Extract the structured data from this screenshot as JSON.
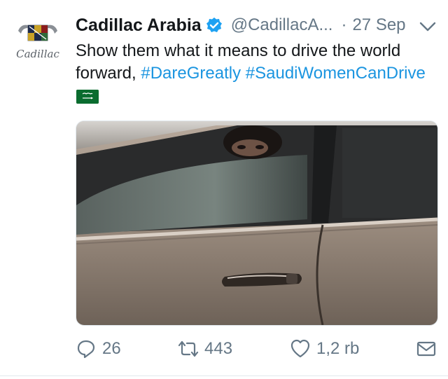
{
  "tweet": {
    "author_name": "Cadillac Arabia",
    "author_handle": "@CadillacA...",
    "separator": "·",
    "timestamp": "27 Sep",
    "logo_text": "Cadillac",
    "verified": true,
    "text_plain": "Show them what it means to drive the world forward, ",
    "hashtag_1": "#DareGreatly",
    "hashtag_2": "#SaudiWomenCanDrive",
    "flag_emoji_name": "saudi-arabia-flag",
    "media_description": "photo",
    "colors": {
      "hashtag": "#1b95e0",
      "verified": "#1da1f2",
      "meta": "#657786",
      "flag": "#0a6c2f"
    }
  },
  "actions": {
    "replies": "26",
    "retweets": "443",
    "likes": "1,2 rb",
    "reply_icon": "reply-icon",
    "retweet_icon": "retweet-icon",
    "like_icon": "heart-icon",
    "dm_icon": "envelope-icon"
  }
}
